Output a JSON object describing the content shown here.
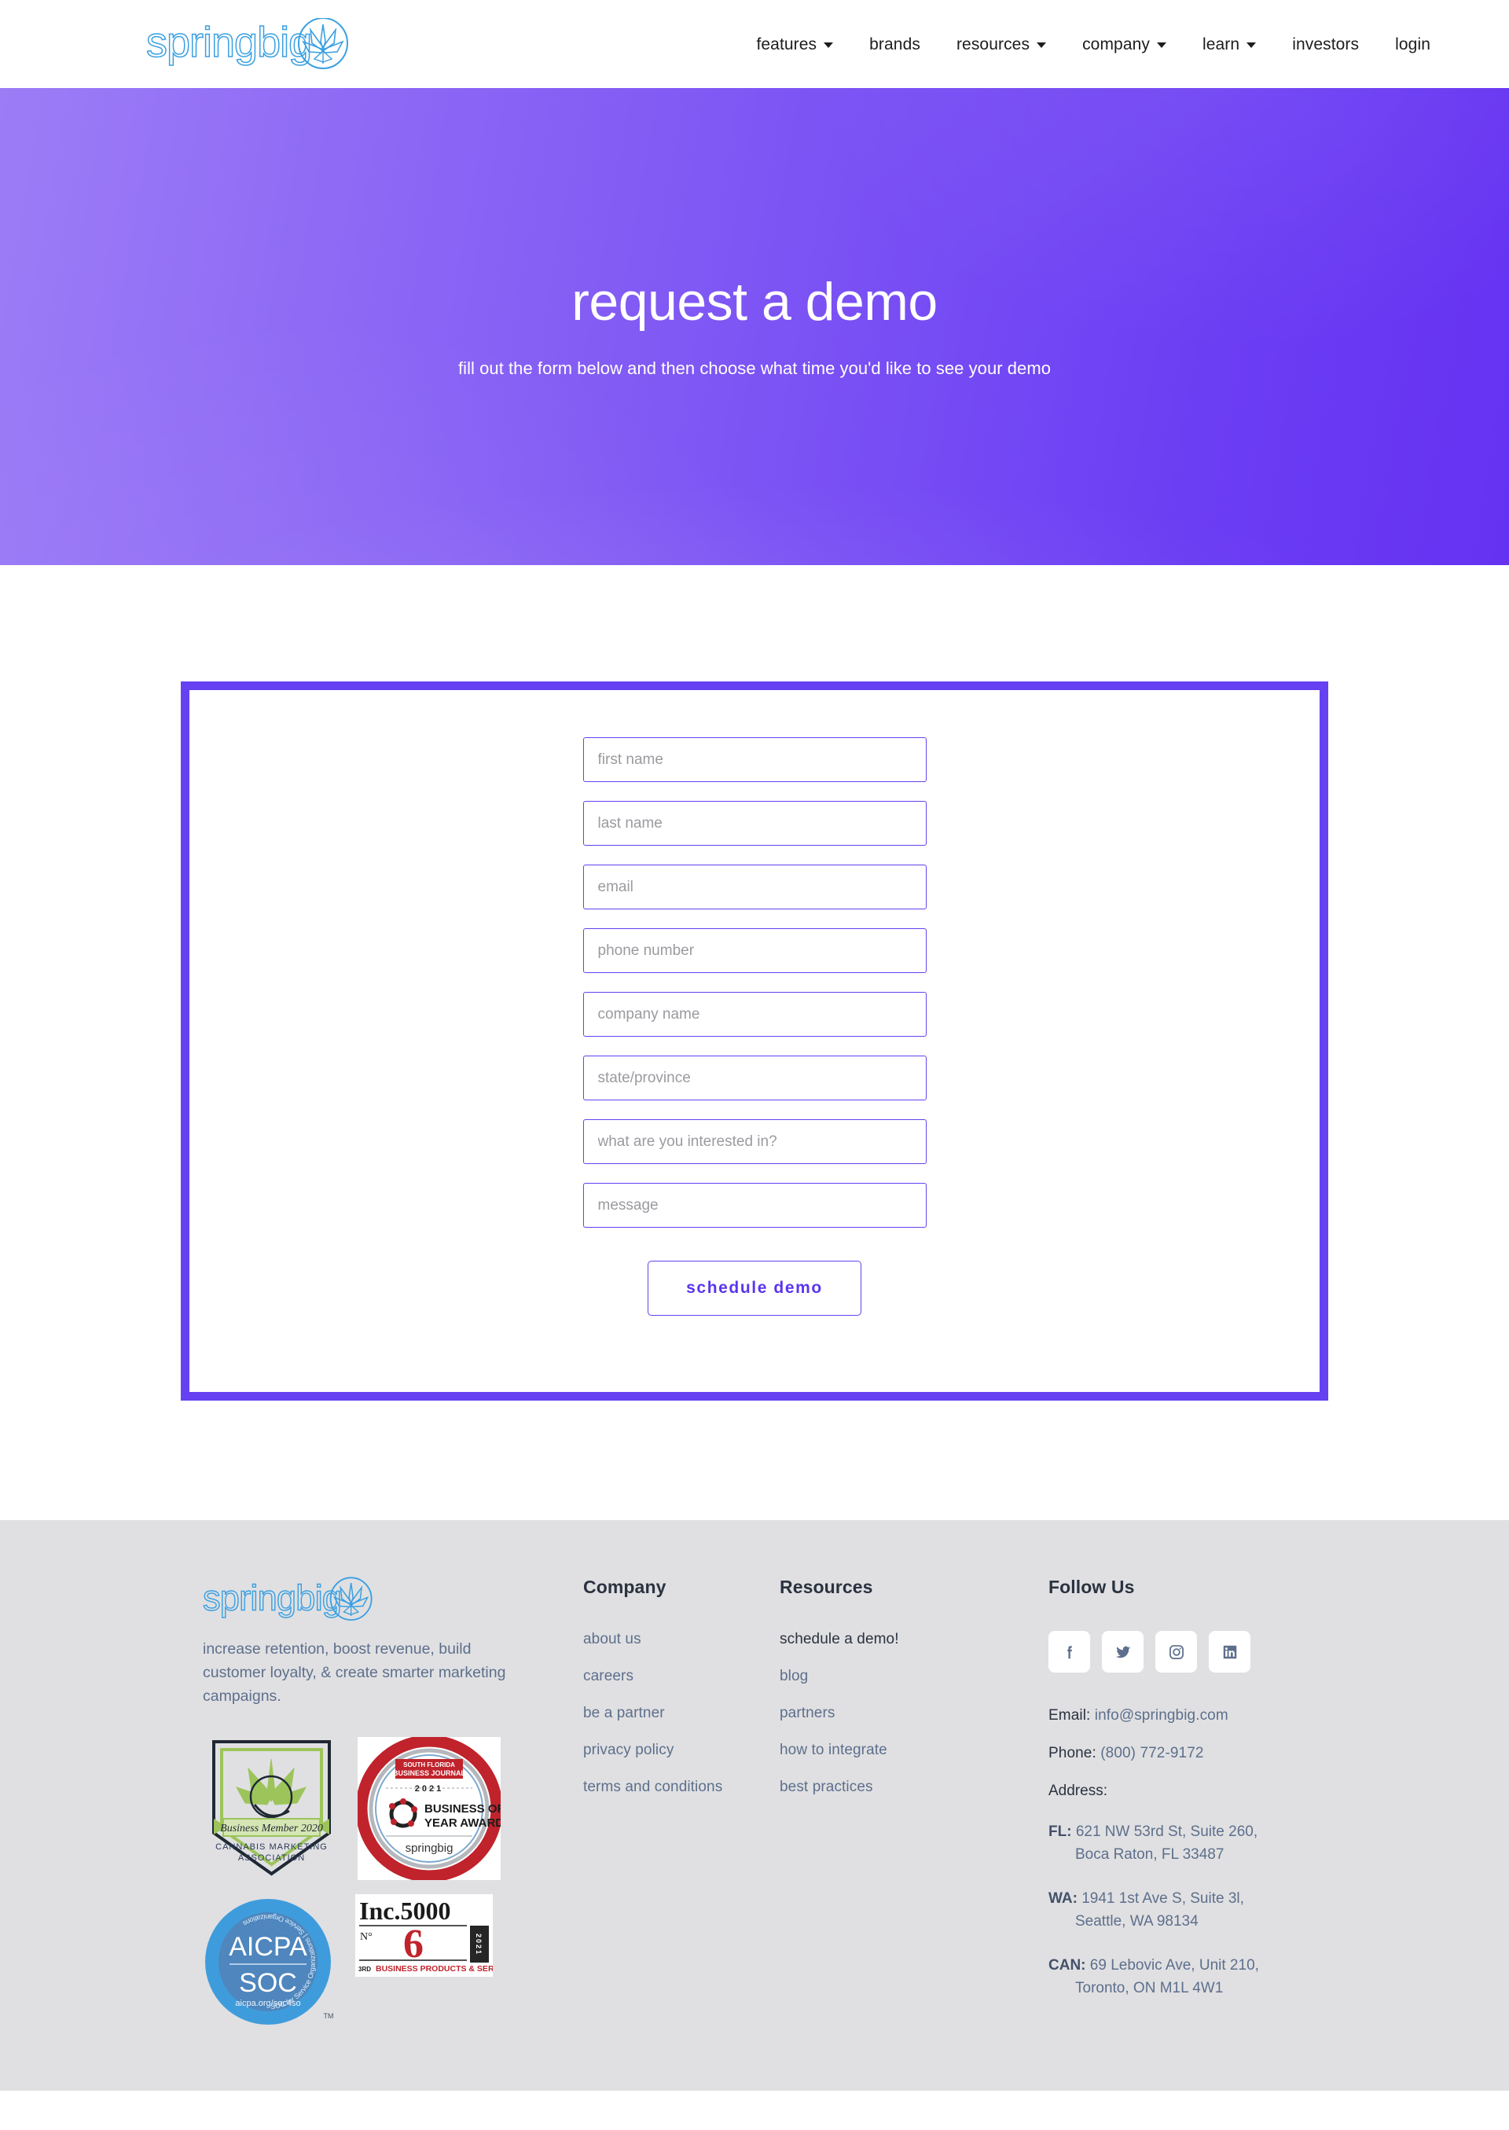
{
  "header": {
    "logo_text": "springbig",
    "logo_icon": "cannabis-leaf-circle-icon",
    "nav": [
      {
        "label": "features",
        "has_dropdown": true
      },
      {
        "label": "brands",
        "has_dropdown": false
      },
      {
        "label": "resources",
        "has_dropdown": true
      },
      {
        "label": "company",
        "has_dropdown": true
      },
      {
        "label": "learn",
        "has_dropdown": true
      },
      {
        "label": "investors",
        "has_dropdown": false
      },
      {
        "label": "login",
        "has_dropdown": false
      }
    ]
  },
  "hero": {
    "title": "request a demo",
    "subtitle": "fill out the form below and then choose what time you'd like to see your demo",
    "gradient_from": "#9D7DF6",
    "gradient_to": "#6532F2"
  },
  "form": {
    "accent_color": "#6541F2",
    "fields": [
      {
        "name": "first-name",
        "placeholder": "first name",
        "value": ""
      },
      {
        "name": "last-name",
        "placeholder": "last name",
        "value": ""
      },
      {
        "name": "email",
        "placeholder": "email",
        "value": ""
      },
      {
        "name": "phone",
        "placeholder": "phone number",
        "value": ""
      },
      {
        "name": "company",
        "placeholder": "company name",
        "value": ""
      },
      {
        "name": "state",
        "placeholder": "state/province",
        "value": ""
      },
      {
        "name": "interest",
        "placeholder": "what are you interested in?",
        "value": ""
      },
      {
        "name": "message",
        "placeholder": "message",
        "value": ""
      }
    ],
    "submit_label": "schedule demo"
  },
  "footer": {
    "brand": {
      "logo_text": "springbig",
      "logo_icon": "cannabis-leaf-circle-icon",
      "tagline": "increase retention, boost revenue, build customer loyalty, & create smarter marketing campaigns."
    },
    "badges": [
      {
        "name": "cannabis-marketing-association-badge",
        "line1": "Business Member 2020",
        "line2": "CANNABIS MARKETING",
        "line3": "ASSOCIATION"
      },
      {
        "name": "business-of-the-year-badge",
        "journal": "SOUTH FLORIDA BUSINESS JOURNAL",
        "year": "2021",
        "title1": "BUSINESS OF THE",
        "title2": "YEAR AWARDS",
        "brand": "springbig"
      },
      {
        "name": "aicpa-soc-badge",
        "line1": "AICPA",
        "line2": "SOC",
        "line3": "aicpa.org/soc4so",
        "ring": "SOC for Service Organizations | Service Organizations",
        "tm": "TM"
      },
      {
        "name": "inc-5000-badge",
        "title": "Inc.5000",
        "no_label": "N°",
        "rank": "6",
        "year": "2021",
        "category": "BUSINESS PRODUCTS & SERVICES",
        "prefix": "3RD"
      }
    ],
    "company": {
      "title": "Company",
      "links": [
        "about us",
        "careers",
        "be a partner",
        "privacy policy",
        "terms and conditions"
      ]
    },
    "resources": {
      "title": "Resources",
      "links": [
        "schedule a demo!",
        "blog",
        "partners",
        "how to integrate",
        "best practices"
      ]
    },
    "follow": {
      "title": "Follow Us",
      "socials": [
        {
          "name": "facebook-icon",
          "label": "Facebook"
        },
        {
          "name": "twitter-icon",
          "label": "Twitter"
        },
        {
          "name": "instagram-icon",
          "label": "Instagram"
        },
        {
          "name": "linkedin-icon",
          "label": "LinkedIn"
        }
      ],
      "email_label": "Email:",
      "email_value": "info@springbig.com",
      "phone_label": "Phone:",
      "phone_value": "(800) 772-9172",
      "address_label": "Address:",
      "addresses": [
        {
          "tag": "FL:",
          "line1": "621 NW 53rd St, Suite 260,",
          "line2": "Boca Raton, FL 33487"
        },
        {
          "tag": "WA:",
          "line1": "1941 1st Ave S, Suite 3l,",
          "line2": "Seattle, WA 98134"
        },
        {
          "tag": "CAN:",
          "line1": "69 Lebovic Ave, Unit 210,",
          "line2": "Toronto, ON M1L 4W1"
        }
      ]
    }
  }
}
